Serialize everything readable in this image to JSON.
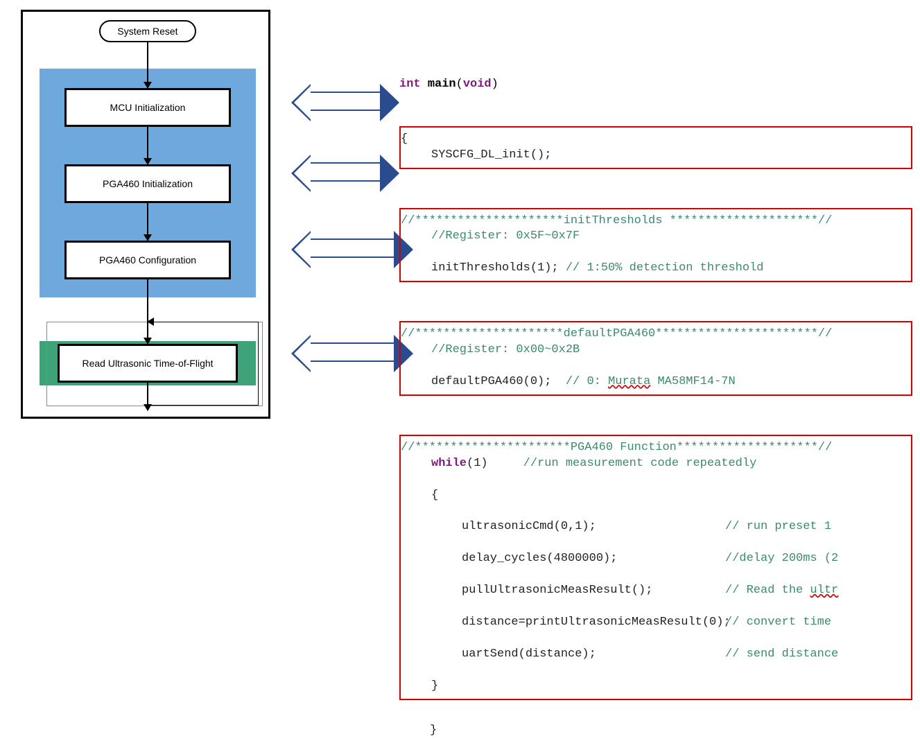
{
  "flowchart": {
    "start": "System Reset",
    "steps": [
      "MCU Initialization",
      "PGA460 Initialization",
      "PGA460 Configuration",
      "Read Ultrasonic Time-of-Flight"
    ]
  },
  "code": {
    "sig_int": "int",
    "sig_main": "main",
    "sig_void": "void",
    "block1": {
      "open": "{",
      "l1": "SYSCFG_DL_init();"
    },
    "block2": {
      "c1": "//*********************initThresholds *********************//",
      "c2": "//Register: 0x5F~0x7F",
      "l1a": "initThresholds(1); ",
      "l1b": "// 1:50% detection threshold"
    },
    "block3": {
      "c1": "//*********************defaultPGA460***********************//",
      "c2": "//Register: 0x00~0x2B",
      "l1a": "defaultPGA460(0);  ",
      "l1b": "// 0: ",
      "l1c": "Murata",
      "l1d": " MA58MF14-7N"
    },
    "block4": {
      "c1": "//**********************PGA460 Function********************//",
      "while_kw": "while",
      "while_cond": "(1)",
      "while_c": "     //run measurement code repeatedly",
      "open": "{",
      "l1a": "ultrasonicCmd(0,1);",
      "l1b": "// run preset 1",
      "l2a": "delay_cycles(4800000);",
      "l2b": "//delay 200ms (2",
      "l3a": "pullUltrasonicMeasResult();",
      "l3b_a": "// Read the ",
      "l3b_b": "ultr",
      "l4a": "distance=printUltrasonicMeasResult(0);",
      "l4b": "// convert time",
      "l5a": "uartSend(distance);",
      "l5b": "// send distance",
      "close": "}"
    },
    "final_close": "}"
  }
}
